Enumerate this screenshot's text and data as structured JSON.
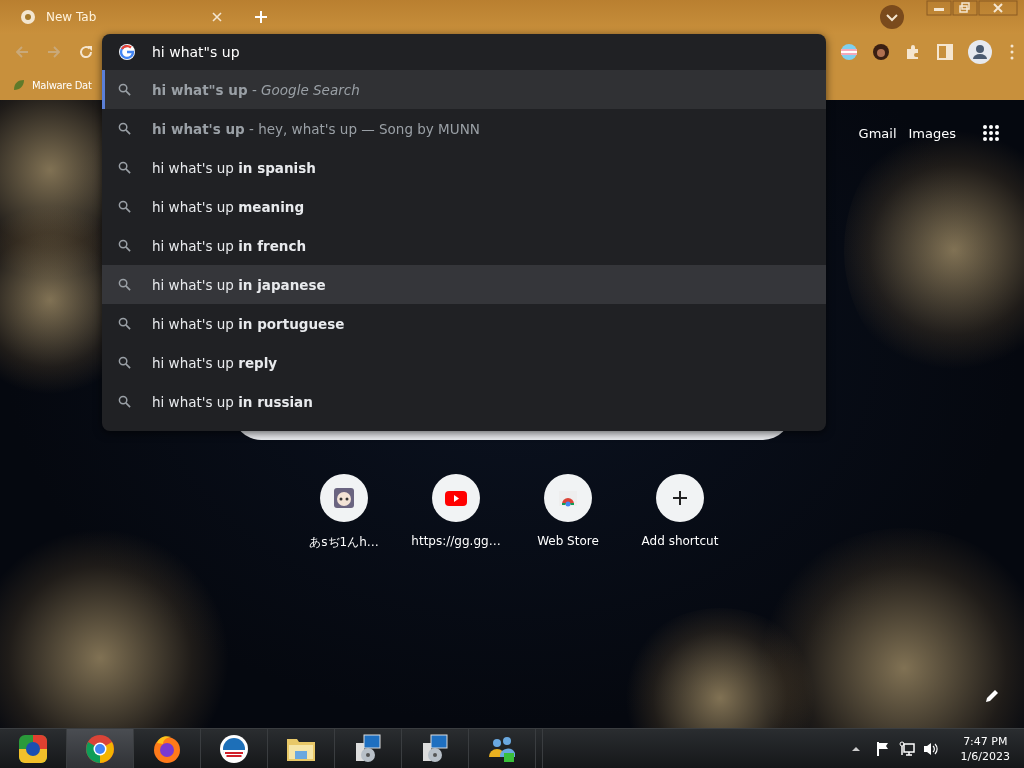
{
  "tab": {
    "title": "New Tab"
  },
  "bookmarks": [
    {
      "label": "Malware Dat"
    }
  ],
  "omnibox": {
    "value": "hi what\"s up",
    "suggestions": [
      {
        "kind": "description",
        "text": "**hi what\"s up** - *Google Search*",
        "selected": true,
        "hovered": false
      },
      {
        "kind": "description",
        "text": "**hi what's up** - hey, what's up — Song by MUNN",
        "selected": false,
        "hovered": false
      },
      {
        "kind": "completion",
        "text": "hi what's up **in spanish**",
        "selected": false,
        "hovered": false
      },
      {
        "kind": "completion",
        "text": "hi what's up **meaning**",
        "selected": false,
        "hovered": false
      },
      {
        "kind": "completion",
        "text": "hi what's up **in french**",
        "selected": false,
        "hovered": false
      },
      {
        "kind": "completion",
        "text": "hi what's up **in japanese**",
        "selected": false,
        "hovered": true
      },
      {
        "kind": "completion",
        "text": "hi what's up **in portuguese**",
        "selected": false,
        "hovered": false
      },
      {
        "kind": "completion",
        "text": "hi what's up **reply**",
        "selected": false,
        "hovered": false
      },
      {
        "kind": "completion",
        "text": "hi what's up **in russian**",
        "selected": false,
        "hovered": false
      }
    ]
  },
  "header_links": [
    "Gmail",
    "Images"
  ],
  "shortcuts": [
    {
      "kind": "avatar",
      "label": "あsぢ1んh…"
    },
    {
      "kind": "video",
      "label": "https://gg.gg…"
    },
    {
      "kind": "store",
      "label": "Web Store"
    },
    {
      "kind": "add",
      "label": "Add shortcut"
    }
  ],
  "taskbar": {
    "apps": [
      {
        "kind": "start",
        "selected": false
      },
      {
        "kind": "chrome",
        "selected": true
      },
      {
        "kind": "firefox",
        "selected": false
      },
      {
        "kind": "logo",
        "selected": false
      },
      {
        "kind": "folder",
        "selected": false
      },
      {
        "kind": "installer",
        "selected": false
      },
      {
        "kind": "installer",
        "selected": false
      },
      {
        "kind": "people",
        "selected": false
      }
    ],
    "time": "7:47 PM",
    "date": "1/6/2023"
  }
}
